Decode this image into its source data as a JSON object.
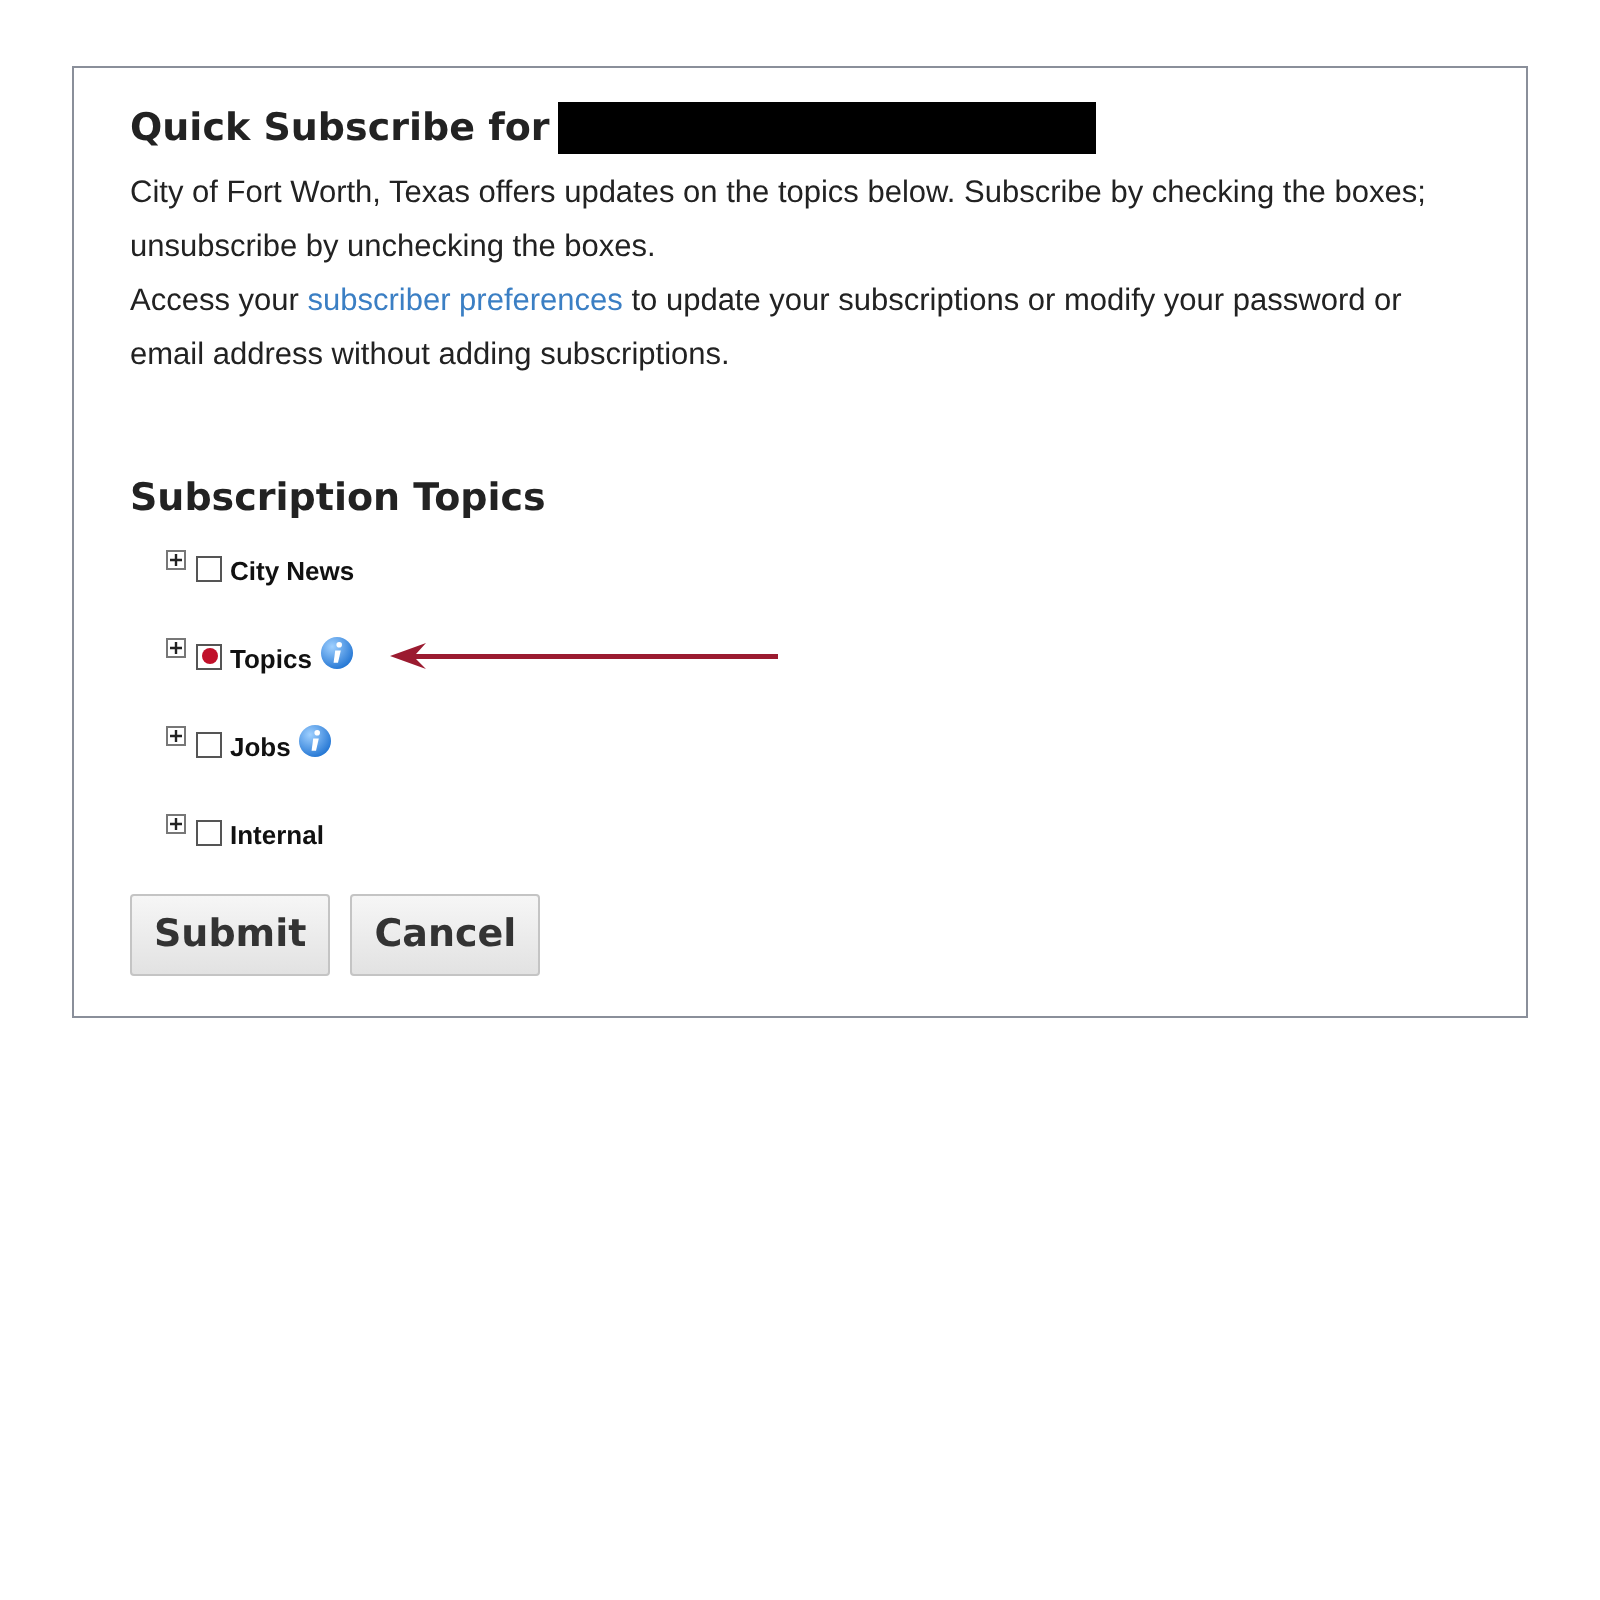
{
  "heading": {
    "text": "Quick Subscribe for",
    "redacted": true
  },
  "intro": "City of Fort Worth, Texas offers updates on the topics below. Subscribe by checking the boxes; unsubscribe by unchecking the boxes.",
  "access": {
    "before": "Access your",
    "link": "subscriber preferences",
    "after": "to update your subscriptions or modify your password or email address without adding subscriptions."
  },
  "topics_title": "Subscription Topics",
  "topics": [
    {
      "label": "City News",
      "checked": false,
      "info": false,
      "arrow": false
    },
    {
      "label": "Topics",
      "checked": true,
      "info": true,
      "arrow": true
    },
    {
      "label": "Jobs",
      "checked": false,
      "info": true,
      "arrow": false
    },
    {
      "label": "Internal",
      "checked": false,
      "info": false,
      "arrow": false
    }
  ],
  "buttons": [
    "Submit",
    "Cancel"
  ]
}
